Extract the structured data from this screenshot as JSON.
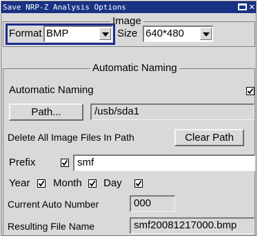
{
  "window": {
    "title": "Save NRP-Z Analysis Options"
  },
  "image_group": {
    "legend": "Image",
    "format_label": "Format",
    "format_value": "BMP",
    "size_label": "Size",
    "size_value": "640*480"
  },
  "naming_group": {
    "legend": "Automatic Naming",
    "auto_naming_label": "Automatic Naming",
    "auto_naming_checked": true,
    "path_button": "Path...",
    "path_value": "/usb/sda1",
    "delete_label": "Delete All Image Files In Path",
    "clear_path_button": "Clear Path",
    "prefix_label": "Prefix",
    "prefix_checked": true,
    "prefix_value": "smf",
    "year_label": "Year",
    "year_checked": true,
    "month_label": "Month",
    "month_checked": true,
    "day_label": "Day",
    "day_checked": true,
    "current_number_label": "Current Auto Number",
    "current_number_value": "000",
    "result_label": "Resulting File Name",
    "result_value": "smf20081217000.bmp"
  }
}
